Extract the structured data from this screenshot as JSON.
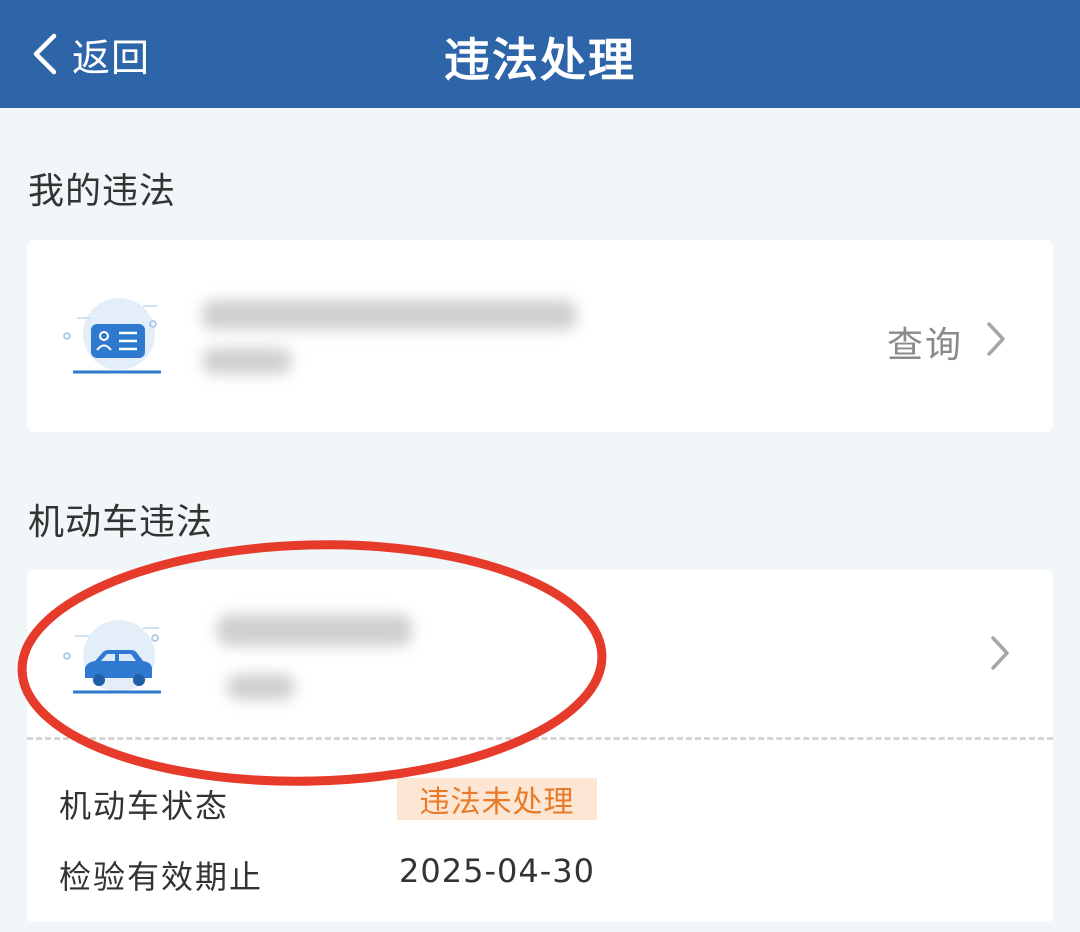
{
  "header": {
    "back_label": "返回",
    "title": "违法处理"
  },
  "my_violations": {
    "section_title": "我的违法",
    "query_label": "查询",
    "icon": "id-card-icon"
  },
  "vehicle_violations": {
    "section_title": "机动车违法",
    "icon": "car-icon",
    "details": [
      {
        "label": "机动车状态",
        "value": "违法未处理"
      },
      {
        "label": "检验有效期止",
        "value": "2025-04-30"
      }
    ]
  },
  "colors": {
    "header_bg": "#2d65a8",
    "page_bg": "#f1f6f9",
    "status_badge_bg": "#fde6d4",
    "status_badge_text": "#e87a28",
    "annotation_red": "#e63a2a"
  }
}
